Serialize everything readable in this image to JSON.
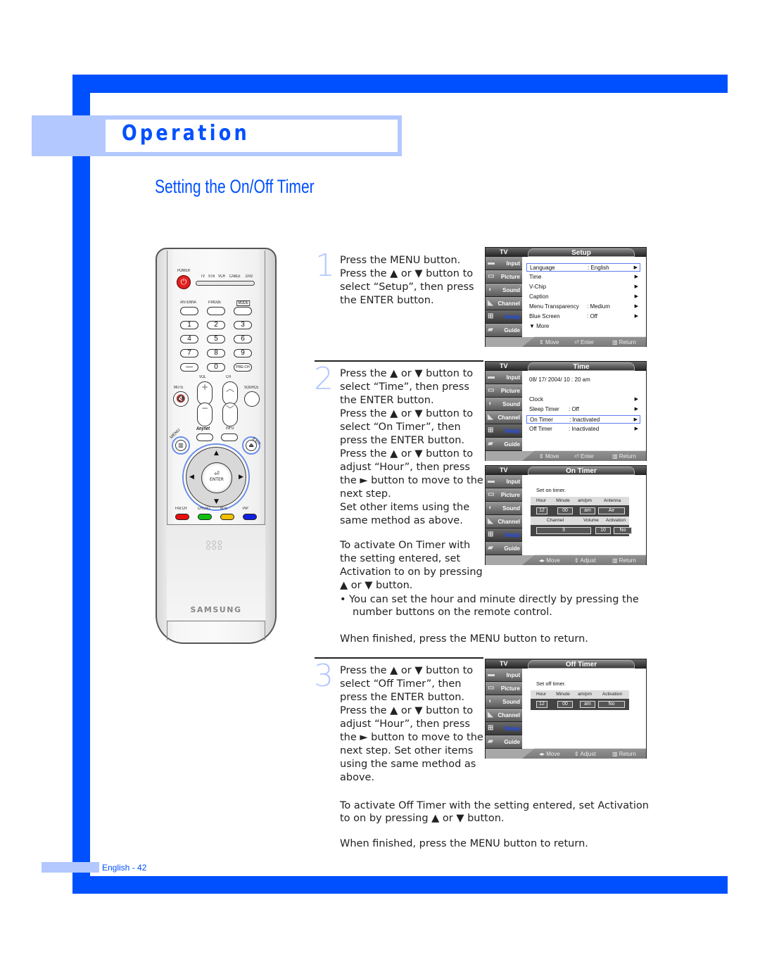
{
  "header": {
    "section": "Operation",
    "title": "Setting the On/Off Timer"
  },
  "footer": {
    "page_label": "English - 42"
  },
  "colors": {
    "brand_blue": "#0050ff",
    "light_blue": "#b3c8ff"
  },
  "remote": {
    "power_label": "POWER",
    "modes": [
      "TV",
      "STB",
      "VCR",
      "CABLE",
      "DVD"
    ],
    "top_buttons": [
      "ANTENNA",
      "P.MODE",
      "MODE"
    ],
    "digits": [
      "1",
      "2",
      "3",
      "4",
      "5",
      "6",
      "7",
      "8",
      "9",
      "—",
      "0",
      "PRE-CH"
    ],
    "vol_label": "VOL",
    "ch_label": "CH",
    "mute_label": "MUTE",
    "source_label": "SOURCE",
    "anynet_label": "Anynet",
    "info_label": "INFO",
    "menu_label": "MENU",
    "exit_label": "EXIT",
    "enter_label": "ENTER",
    "color_buttons": [
      {
        "label": "FAV.CH",
        "color": "#e81010"
      },
      {
        "label": "CH.LIST",
        "color": "#10c010"
      },
      {
        "label": "MTS",
        "color": "#f0c000"
      },
      {
        "label": "PIP",
        "color": "#1020e0"
      }
    ],
    "brand": "SAMSUNG"
  },
  "steps": [
    {
      "number": "1",
      "paragraphs": [
        "Press the MENU button. Press the ▲ or ▼ button to select “Setup”, then press the ENTER button."
      ]
    },
    {
      "number": "2",
      "paragraphs": [
        "Press the ▲ or ▼ button to select “Time”, then press the ENTER button.",
        "Press the ▲ or ▼ button to select “On Timer”, then press the ENTER button.",
        "Press the ▲ or ▼ button to adjust “Hour”, then press the ► button to move to the next step.",
        "Set other items using the same method as above.",
        "To activate On Timer with the setting entered, set Activation to on by pressing ▲ or ▼ button."
      ]
    },
    {
      "number": "3",
      "paragraphs": [
        "Press the ▲ or ▼ button to select “Off Timer”, then press the ENTER button.",
        "Press the ▲ or ▼ button to adjust “Hour”, then press the ► button to move to the next step. Set other items using the same method as above."
      ]
    }
  ],
  "notes": {
    "bullet": "You can set the hour and minute directly by pressing the number buttons on the remote control.",
    "finish1": "When finished, press the MENU button to return.",
    "offtimer_activate": "To activate Off Timer with the setting entered, set Activation to on by pressing ▲ or ▼ button.",
    "finish2": "When finished, press the MENU button to return."
  },
  "osd_common": {
    "tv_label": "TV",
    "sidebar": [
      {
        "label": "Input",
        "icon": "input-icon"
      },
      {
        "label": "Picture",
        "icon": "picture-icon"
      },
      {
        "label": "Sound",
        "icon": "sound-icon"
      },
      {
        "label": "Channel",
        "icon": "channel-icon"
      },
      {
        "label": "Setup",
        "icon": "setup-icon",
        "active": true
      },
      {
        "label": "Guide",
        "icon": "guide-icon"
      }
    ]
  },
  "osd_setup": {
    "title": "Setup",
    "items": [
      {
        "label": "Language",
        "value": ": English",
        "selected": true
      },
      {
        "label": "Time",
        "value": ""
      },
      {
        "label": "V-Chip",
        "value": ""
      },
      {
        "label": "Caption",
        "value": ""
      },
      {
        "label": "Menu Transparency",
        "value": ": Medium"
      },
      {
        "label": "Blue Screen",
        "value": ": Off"
      }
    ],
    "more": "▼ More",
    "footer": [
      "Move",
      "Enter",
      "Return"
    ]
  },
  "osd_time": {
    "title": "Time",
    "datetime": "08/ 17/ 2004/ 10 : 20 am",
    "items": [
      {
        "label": "Clock",
        "value": ""
      },
      {
        "label": "Sleep Timer",
        "value": ": Off"
      },
      {
        "label": "On Timer",
        "value": ": Inactivated",
        "selected": true
      },
      {
        "label": "Off Timer",
        "value": ": Inactivated"
      }
    ],
    "footer": [
      "Move",
      "Enter",
      "Return"
    ]
  },
  "osd_ontimer": {
    "title": "On Timer",
    "caption": "Set on timer.",
    "headers1": [
      "Hour",
      "Minute",
      "am/pm",
      "Antenna"
    ],
    "values1": [
      "12",
      "00",
      "am",
      "Air"
    ],
    "headers2": [
      "Channel",
      "Volume",
      "Activation"
    ],
    "values2": [
      "3",
      "10",
      "No"
    ],
    "footer": [
      "Move",
      "Adjust",
      "Return"
    ]
  },
  "osd_offtimer": {
    "title": "Off Timer",
    "caption": "Set off timer.",
    "headers1": [
      "Hour",
      "Minute",
      "am/pm",
      "Activation"
    ],
    "values1": [
      "12",
      "00",
      "am",
      "No"
    ],
    "footer": [
      "Move",
      "Adjust",
      "Return"
    ]
  }
}
